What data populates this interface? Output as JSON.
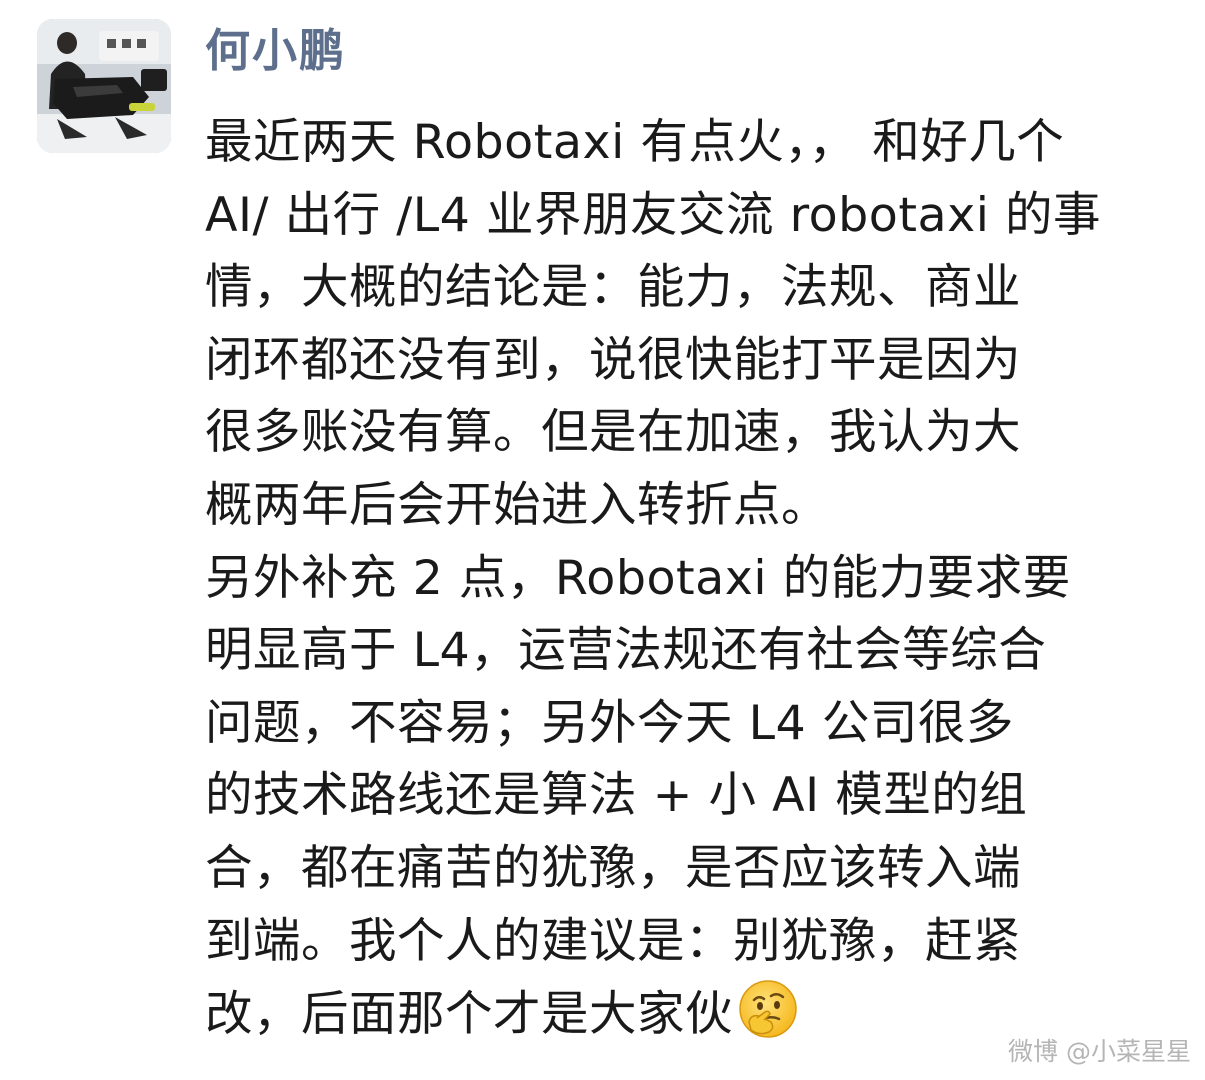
{
  "post": {
    "author": "何小鹏",
    "lines": [
      "最近两天 Robotaxi 有点火，， 和好几个",
      "AI/ 出行 /L4 业界朋友交流 robotaxi 的事",
      "情，大概的结论是：能力，法规、商业",
      "闭环都还没有到，说很快能打平是因为",
      "很多账没有算。但是在加速，我认为大",
      "概两年后会开始进入转折点。",
      "另外补充 2 点，Robotaxi 的能力要求要",
      "明显高于 L4，运营法规还有社会等综合",
      "问题，不容易；另外今天 L4 公司很多",
      "的技术路线还是算法 + 小 AI 模型的组",
      "合，都在痛苦的犹豫，是否应该转入端",
      "到端。我个人的建议是：别犹豫，赶紧",
      "改，后面那个才是大家伙"
    ],
    "final_emoji": "thinking-face-emoji"
  },
  "watermark": "微博 @小菜星星"
}
